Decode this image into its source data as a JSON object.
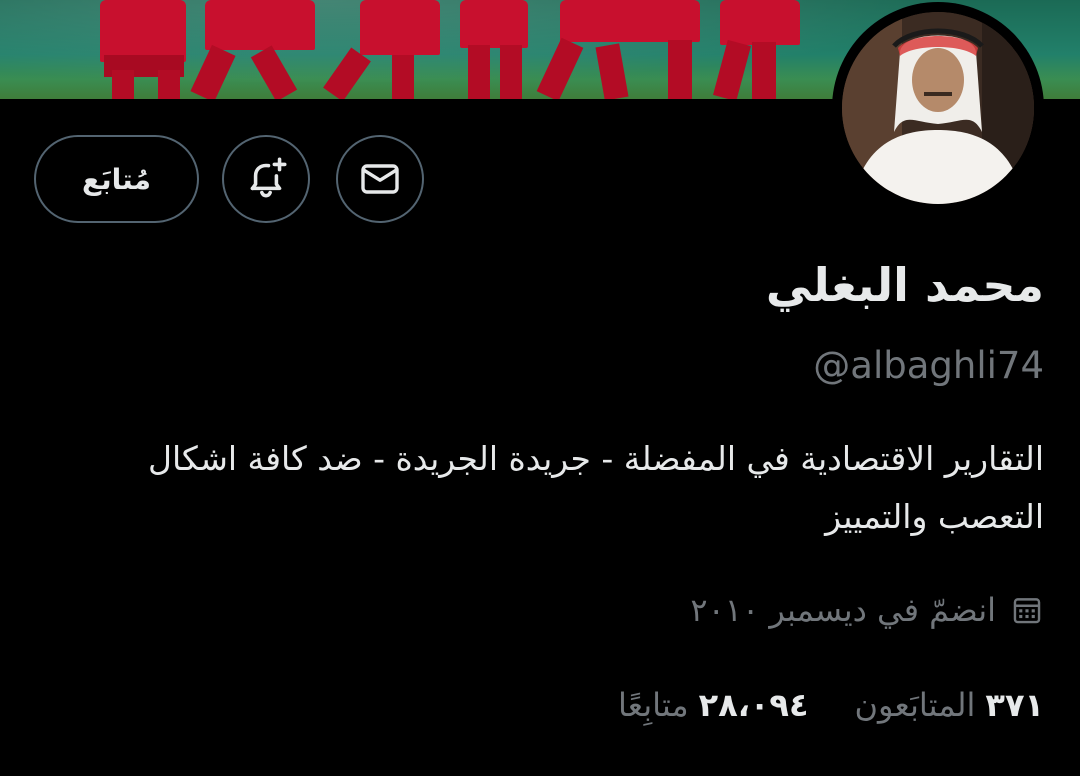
{
  "profile": {
    "name": "محمد البغلي",
    "handle": "@albaghli74",
    "bio": "التقارير الاقتصادية في المفضلة - جريدة الجريدة - ضد كافة اشكال التعصب والتمييز",
    "joined": "انضمّ في ديسمبر ٢٠١٠"
  },
  "actions": {
    "follow_label": "مُتابَع"
  },
  "stats": {
    "following_count": "٣٧١",
    "following_label": "المتابَعون",
    "followers_count": "٢٨،٠٩٤",
    "followers_label": "متابِعًا"
  },
  "icons": {
    "message": "mail-icon",
    "notify": "bell-plus-icon",
    "joined": "calendar-icon"
  },
  "colors": {
    "background": "#000000",
    "text": "#e7e9ea",
    "muted": "#71767b",
    "border": "#536471"
  }
}
